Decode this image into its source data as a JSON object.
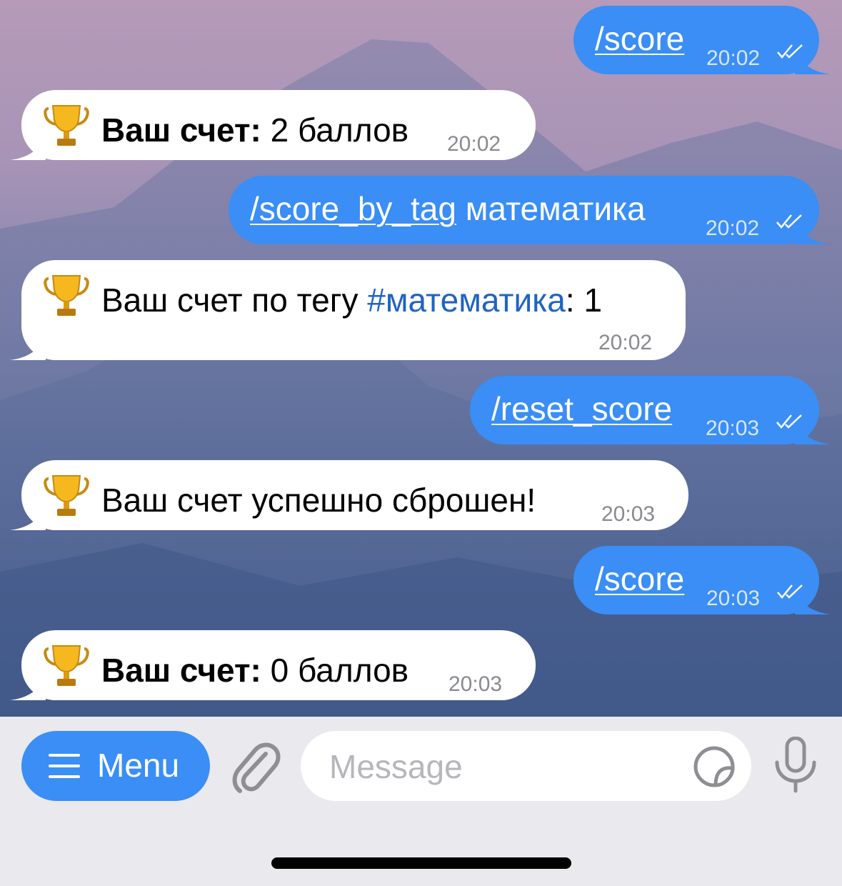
{
  "messages": [
    {
      "direction": "out",
      "command": "/score",
      "extra": "",
      "time": "20:02",
      "status": "double-check"
    },
    {
      "direction": "in",
      "icon": "trophy-icon",
      "bold": "Ваш счет:",
      "text": " 2 баллов",
      "time": "20:02"
    },
    {
      "direction": "out",
      "command": "/score_by_tag",
      "extra": " математика",
      "time": "20:02",
      "status": "double-check"
    },
    {
      "direction": "in",
      "icon": "trophy-icon",
      "text_before": "Ваш счет по тегу ",
      "hashtag": "#математика",
      "text_after": ": 1",
      "time": "20:02"
    },
    {
      "direction": "out",
      "command": "/reset_score",
      "extra": "",
      "time": "20:03",
      "status": "double-check"
    },
    {
      "direction": "in",
      "icon": "trophy-icon",
      "text": "Ваш счет успешно сброшен!",
      "time": "20:03"
    },
    {
      "direction": "out",
      "command": "/score",
      "extra": "",
      "time": "20:03",
      "status": "double-check"
    },
    {
      "direction": "in",
      "icon": "trophy-icon",
      "bold": "Ваш счет:",
      "text": " 0 баллов",
      "time": "20:03"
    }
  ],
  "input_bar": {
    "menu_label": "Menu",
    "menu_icon": "hamburger-icon",
    "attach_icon": "paperclip-icon",
    "placeholder": "Message",
    "sticker_icon": "sticker-icon",
    "mic_icon": "microphone-icon"
  },
  "colors": {
    "outgoing_bubble": "#3a8ef5",
    "incoming_bubble": "#ffffff",
    "hashtag": "#1f63c4",
    "input_bar_bg": "#e9e9ee"
  }
}
